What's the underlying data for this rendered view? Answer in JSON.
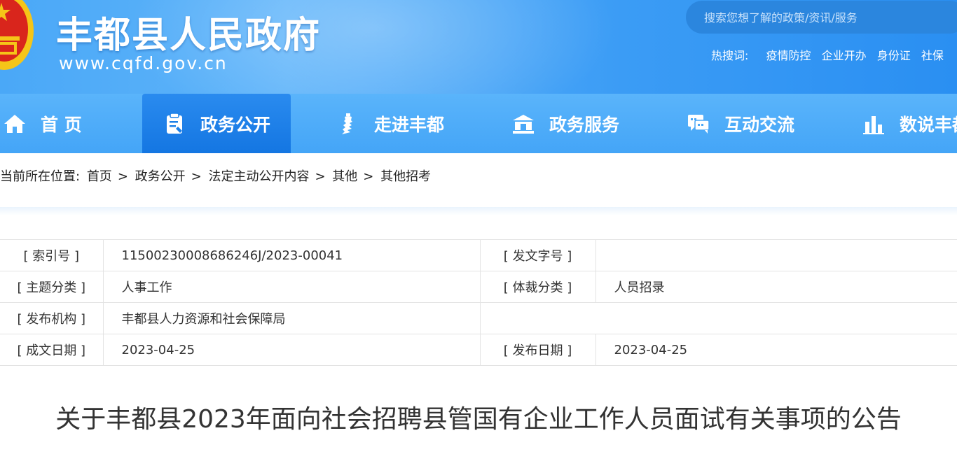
{
  "header": {
    "site_title": "丰都县人民政府",
    "site_url": "www.cqfd.gov.cn",
    "search_placeholder": "搜索您想了解的政策/资讯/服务",
    "hot_label": "热搜词:",
    "hot_words": [
      "疫情防控",
      "企业开办",
      "身份证",
      "社保"
    ]
  },
  "nav": {
    "items": [
      {
        "label": "首 页",
        "icon": "home-icon"
      },
      {
        "label": "政务公开",
        "icon": "document-icon",
        "active": true
      },
      {
        "label": "走进丰都",
        "icon": "landmark-icon"
      },
      {
        "label": "政务服务",
        "icon": "government-building-icon"
      },
      {
        "label": "互动交流",
        "icon": "chat-icon"
      },
      {
        "label": "数说丰都",
        "icon": "bar-chart-icon"
      }
    ]
  },
  "breadcrumb": {
    "prefix": "当前所在位置:",
    "items": [
      "首页",
      "政务公开",
      "法定主动公开内容",
      "其他",
      "其他招考"
    ],
    "separator": ">"
  },
  "info": {
    "index_label": "[ 索引号 ]",
    "index_value": "11500230008686246J/2023-00041",
    "doc_number_label": "[ 发文字号 ]",
    "doc_number_value": "",
    "topic_label": "[ 主题分类 ]",
    "topic_value": "人事工作",
    "genre_label": "[ 体裁分类 ]",
    "genre_value": "人员招录",
    "publisher_label": "[ 发布机构 ]",
    "publisher_value": "丰都县人力资源和社会保障局",
    "written_date_label": "[ 成文日期 ]",
    "written_date_value": "2023-04-25",
    "publish_date_label": "[ 发布日期 ]",
    "publish_date_value": "2023-04-25"
  },
  "article": {
    "title": "关于丰都县2023年面向社会招聘县管国有企业工作人员面试有关事项的公告"
  },
  "colors": {
    "header_blue": "#3b9cf5",
    "nav_active": "#1476e2",
    "emblem_red": "#d9251c",
    "emblem_gold": "#f5c518"
  }
}
